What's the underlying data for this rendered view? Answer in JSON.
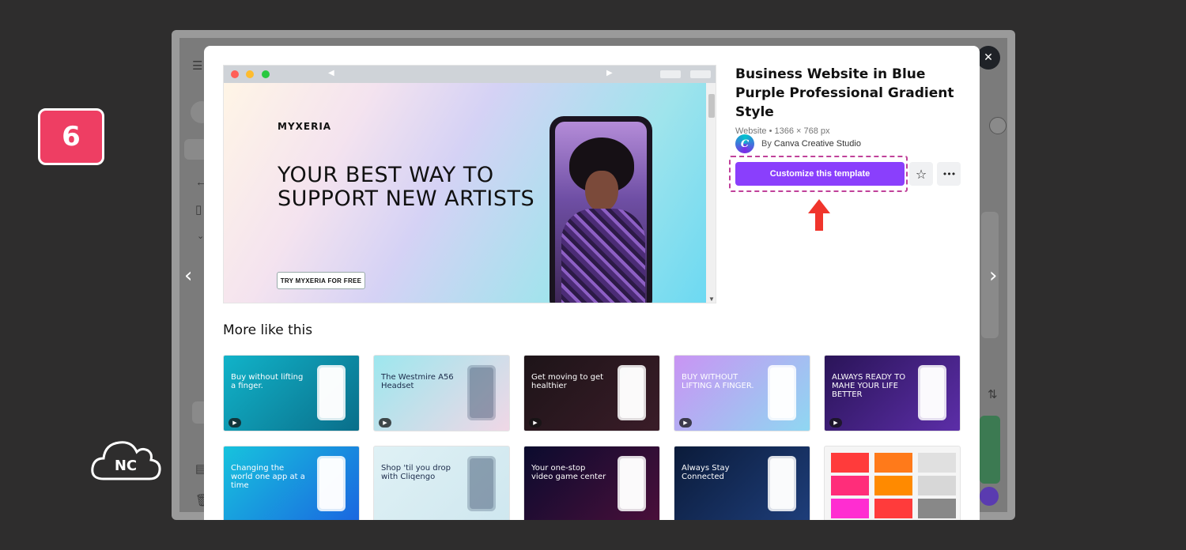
{
  "step_badge": "6",
  "nc_logo_text": "NC",
  "modal": {
    "close_glyph": "✕",
    "nav_prev": "‹",
    "nav_next": "›",
    "title": "Business Website in Blue Purple Professional Gradient Style",
    "meta": "Website • 1366 × 768 px",
    "creator_prefix": "By",
    "creator_name": "Canva Creative Studio",
    "customize_label": "Customize this template",
    "star_icon": "☆",
    "more_icon": "•••",
    "preview": {
      "brand": "MYXERIA",
      "headline": "YOUR BEST WAY TO SUPPORT NEW ARTISTS",
      "cta": "TRY MYXERIA FOR FREE"
    },
    "more_title": "More like this",
    "tiles": [
      {
        "text": "Buy without lifting a finger.",
        "bg": "linear-gradient(135deg,#11b3c9,#0a6e8a)",
        "color": "#ffffff",
        "video": true
      },
      {
        "text": "The Westmire A56 Headset",
        "bg": "linear-gradient(135deg,#9de7ee,#f0d7e6)",
        "color": "#1b2b4a",
        "video": true
      },
      {
        "text": "Get moving to get healthier",
        "bg": "linear-gradient(135deg,#1d1418,#3a1c28)",
        "color": "#ffffff",
        "video": true
      },
      {
        "text": "BUY WITHOUT LIFTING A FINGER.",
        "bg": "linear-gradient(135deg,#c994f3,#8fd7f2)",
        "color": "#ffffff",
        "video": true
      },
      {
        "text": "ALWAYS READY TO MAHE YOUR LIFE BETTER",
        "bg": "linear-gradient(135deg,#2a1458,#5c2ea8)",
        "color": "#ffffff",
        "video": true
      },
      {
        "text": "Changing the world one app at a time",
        "bg": "linear-gradient(135deg,#17c3dd,#1a66e0)",
        "color": "#ffffff",
        "video": false
      },
      {
        "text": "Shop 'til you drop with Cliqengo",
        "bg": "linear-gradient(135deg,#dff1f5,#cfe7ef)",
        "color": "#1b2b4a",
        "video": false
      },
      {
        "text": "Your one-stop video game center",
        "bg": "linear-gradient(135deg,#0b0b2e,#4a0f3a)",
        "color": "#ffffff",
        "video": false
      },
      {
        "text": "Always Stay Connected",
        "bg": "linear-gradient(135deg,#0b1b3a,#1e3e7a)",
        "color": "#ffffff",
        "video": false
      },
      {
        "text": "",
        "bg": "#f5f5f5",
        "color": "#111111",
        "video": false
      }
    ]
  },
  "colors": {
    "accent": "#8a3ffc",
    "badge": "#ee3e63",
    "highlight": "#c0419a",
    "arrow": "#f0352c"
  }
}
